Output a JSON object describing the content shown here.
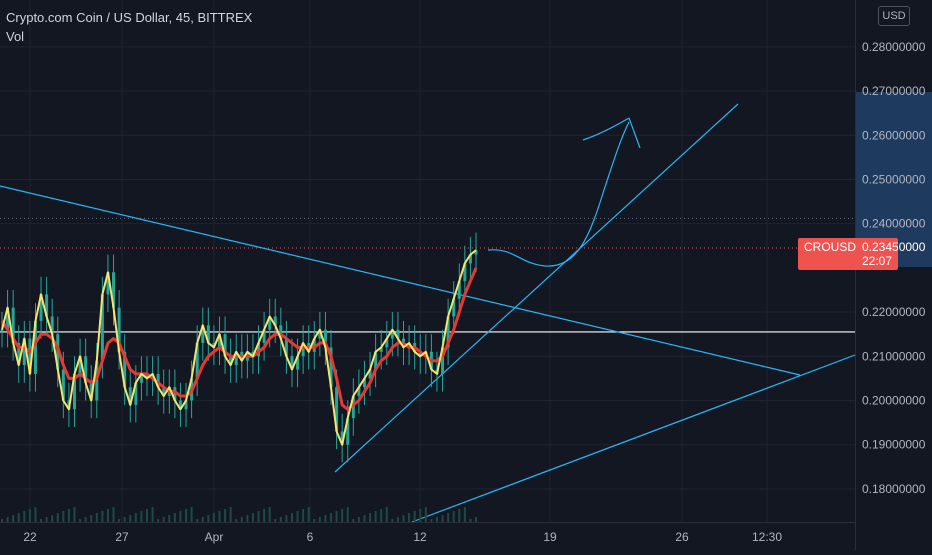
{
  "legend": {
    "title": "Crypto.com Coin / US Dollar, 45, BITTREX",
    "volume_label": "Vol"
  },
  "currency_button": "USD",
  "price_tag": {
    "symbol": "CROUSD",
    "value": "0.23450000",
    "countdown": "22:07"
  },
  "colors": {
    "background": "#131722",
    "candles": "#26a69a",
    "ema_fast": "#f5e66a",
    "ema_slow": "#e53935",
    "trendline": "#29b6f6",
    "support_line": "#ffffff",
    "price_tag": "#ef5350",
    "axis_text": "#b2b5be"
  },
  "chart_data": {
    "type": "line",
    "title": "Crypto.com Coin / US Dollar, 45, BITTREX",
    "x_tick_labels": [
      "22",
      "27",
      "Apr",
      "6",
      "12",
      "19",
      "26",
      "12:30"
    ],
    "y_tick_labels": [
      "0.28000000",
      "0.27000000",
      "0.26000000",
      "0.25000000",
      "0.24000000",
      "0.22000000",
      "0.21000000",
      "0.20000000",
      "0.19000000",
      "0.18000000"
    ],
    "ylim": [
      0.1725,
      0.2906
    ],
    "grid": true,
    "last_price": 0.2345,
    "horizontal_level": 0.2155,
    "series": [
      {
        "values": [
          0.216,
          0.221,
          0.213,
          0.208,
          0.214,
          0.206,
          0.218,
          0.224,
          0.219,
          0.215,
          0.207,
          0.2,
          0.198,
          0.206,
          0.21,
          0.204,
          0.2,
          0.209,
          0.224,
          0.229,
          0.221,
          0.211,
          0.203,
          0.199,
          0.204,
          0.206,
          0.205,
          0.206,
          0.203,
          0.201,
          0.203,
          0.2,
          0.198,
          0.2,
          0.205,
          0.213,
          0.217,
          0.213,
          0.212,
          0.215,
          0.21,
          0.208,
          0.211,
          0.209,
          0.211,
          0.21,
          0.213,
          0.216,
          0.219,
          0.217,
          0.214,
          0.21,
          0.207,
          0.21,
          0.213,
          0.211,
          0.214,
          0.216,
          0.212,
          0.203,
          0.193,
          0.19,
          0.196,
          0.201,
          0.203,
          0.205,
          0.207,
          0.211,
          0.212,
          0.214,
          0.216,
          0.214,
          0.212,
          0.213,
          0.211,
          0.21,
          0.211,
          0.207,
          0.206,
          0.212,
          0.219,
          0.223,
          0.227,
          0.231,
          0.233,
          0.234
        ]
      },
      {
        "values": [
          0.218,
          0.216,
          0.214,
          0.212,
          0.212,
          0.211,
          0.213,
          0.215,
          0.215,
          0.214,
          0.212,
          0.208,
          0.205,
          0.205,
          0.206,
          0.205,
          0.204,
          0.205,
          0.209,
          0.213,
          0.214,
          0.213,
          0.21,
          0.207,
          0.206,
          0.206,
          0.206,
          0.205,
          0.204,
          0.203,
          0.202,
          0.202,
          0.201,
          0.201,
          0.202,
          0.205,
          0.208,
          0.21,
          0.211,
          0.212,
          0.211,
          0.21,
          0.21,
          0.21,
          0.21,
          0.21,
          0.211,
          0.212,
          0.214,
          0.215,
          0.215,
          0.214,
          0.213,
          0.212,
          0.212,
          0.212,
          0.212,
          0.213,
          0.213,
          0.21,
          0.205,
          0.199,
          0.198,
          0.199,
          0.2,
          0.202,
          0.204,
          0.207,
          0.209,
          0.21,
          0.212,
          0.213,
          0.213,
          0.212,
          0.212,
          0.211,
          0.21,
          0.209,
          0.209,
          0.21,
          0.213,
          0.216,
          0.22,
          0.224,
          0.227,
          0.23
        ]
      }
    ]
  }
}
